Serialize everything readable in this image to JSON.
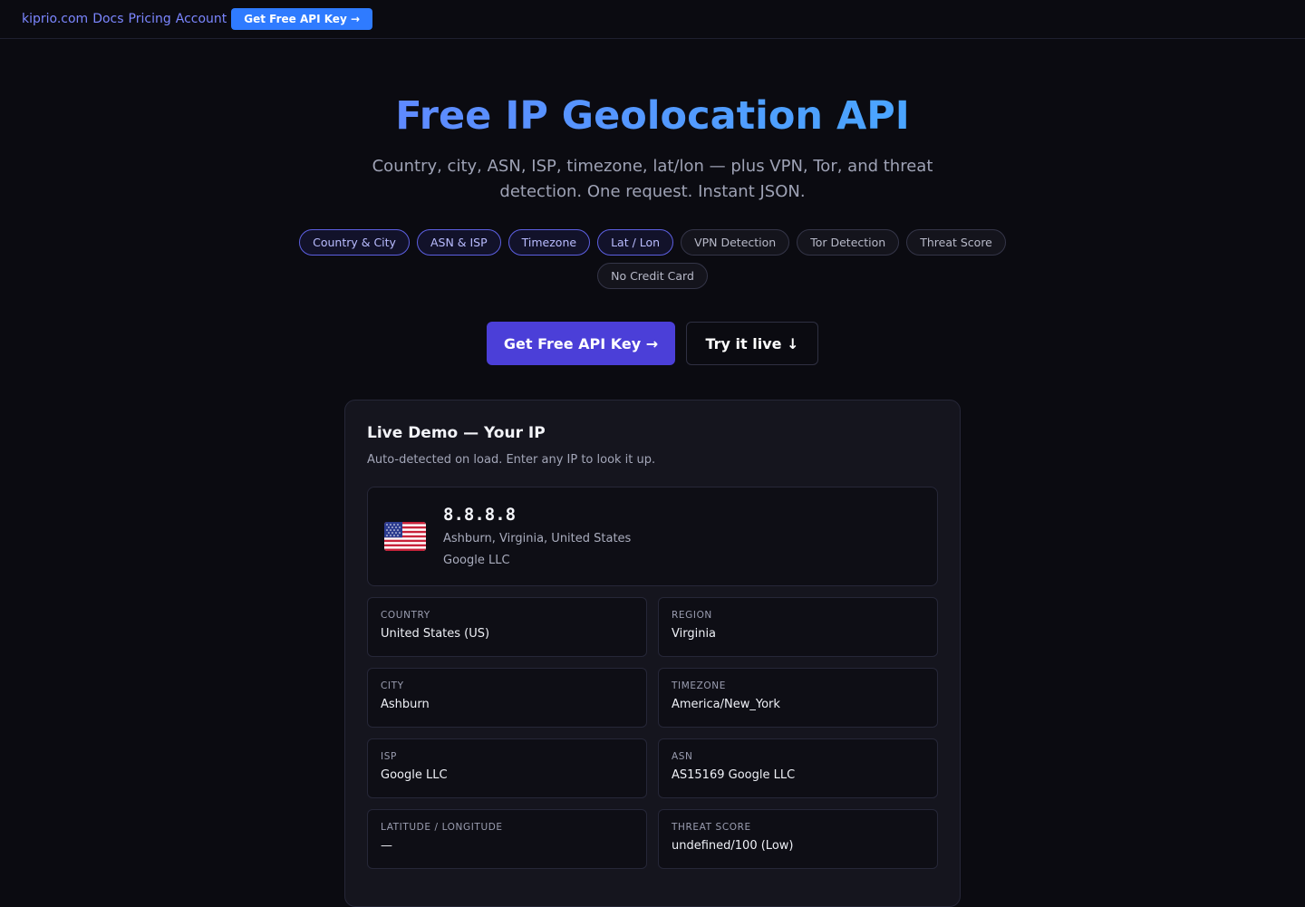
{
  "nav": {
    "brand": "kiprio.com",
    "links": [
      "Docs",
      "Pricing",
      "Account"
    ],
    "cta": "Get Free API Key →"
  },
  "hero": {
    "title": "Free IP Geolocation API",
    "subtitle": "Country, city, ASN, ISP, timezone, lat/lon — plus VPN, Tor, and threat detection. One request. Instant JSON.",
    "pills": [
      {
        "label": "Country & City",
        "accent": true
      },
      {
        "label": "ASN & ISP",
        "accent": true
      },
      {
        "label": "Timezone",
        "accent": true
      },
      {
        "label": "Lat / Lon",
        "accent": true
      },
      {
        "label": "VPN Detection",
        "accent": false
      },
      {
        "label": "Tor Detection",
        "accent": false
      },
      {
        "label": "Threat Score",
        "accent": false
      },
      {
        "label": "No Credit Card",
        "accent": false
      }
    ],
    "primary_cta": "Get Free API Key →",
    "secondary_cta": "Try it live ↓"
  },
  "demo": {
    "title": "Live Demo — Your IP",
    "subtitle": "Auto-detected on load. Enter any IP to look it up.",
    "ip": "8.8.8.8",
    "location": "Ashburn, Virginia, United States",
    "org": "Google LLC",
    "flag_icon": "us-flag-icon",
    "fields": [
      {
        "label": "Country",
        "value": "United States (US)"
      },
      {
        "label": "Region",
        "value": "Virginia"
      },
      {
        "label": "City",
        "value": "Ashburn"
      },
      {
        "label": "Timezone",
        "value": "America/New_York"
      },
      {
        "label": "ISP",
        "value": "Google LLC"
      },
      {
        "label": "ASN",
        "value": "AS15169 Google LLC"
      },
      {
        "label": "Latitude / Longitude",
        "value": "—"
      },
      {
        "label": "Threat Score",
        "value": "undefined/100 (Low)"
      }
    ]
  },
  "colors": {
    "background": "#0b0b11",
    "accent": "#4b3fd8",
    "nav_cta": "#2f7bff",
    "link": "#7b86ff"
  }
}
